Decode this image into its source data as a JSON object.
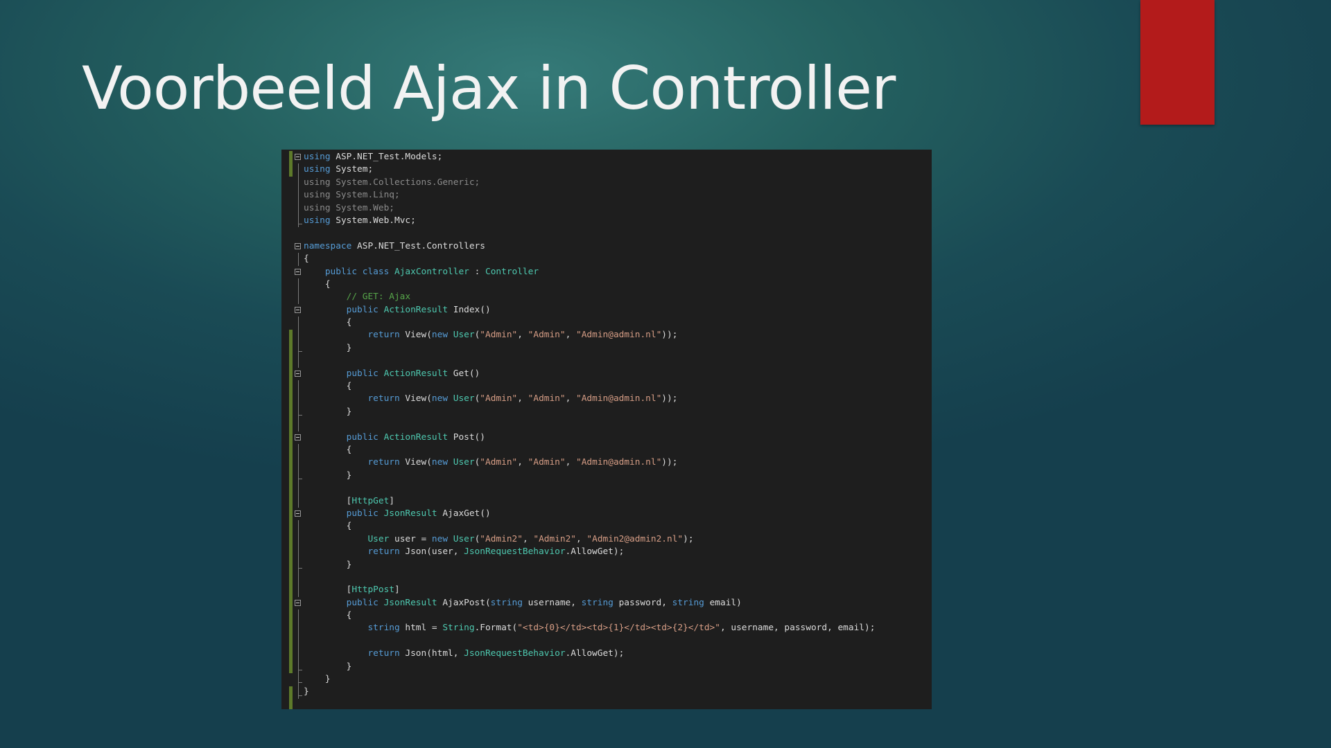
{
  "slide": {
    "title": "Voorbeeld Ajax in Controller",
    "accent_color": "#b31b1b"
  },
  "editor": {
    "colors": {
      "background": "#1e1e1e",
      "plain": "#dcdcdc",
      "keyword": "#569cd6",
      "type": "#4ec9b0",
      "string": "#d69d85",
      "comment": "#57a64a",
      "dimmed": "#8c8c8c",
      "change_marker": "#5d7a2a"
    },
    "change_markers": [
      {
        "from_line": 0,
        "to_line": 1
      },
      {
        "from_line": 14,
        "to_line": 40
      },
      {
        "from_line": 42,
        "to_line": 43
      }
    ],
    "lines": [
      {
        "fold": true,
        "guide": "",
        "indent": 0,
        "tokens": [
          {
            "t": "using",
            "c": "keyword"
          },
          {
            "t": " ASP.NET_Test.Models;",
            "c": "plain"
          }
        ]
      },
      {
        "fold": false,
        "guide": "line",
        "indent": 0,
        "tokens": [
          {
            "t": "using",
            "c": "keyword"
          },
          {
            "t": " System;",
            "c": "plain"
          }
        ]
      },
      {
        "fold": false,
        "guide": "line",
        "indent": 0,
        "tokens": [
          {
            "t": "using System.Collections.Generic;",
            "c": "dimmed"
          }
        ]
      },
      {
        "fold": false,
        "guide": "line",
        "indent": 0,
        "tokens": [
          {
            "t": "using System.Linq;",
            "c": "dimmed"
          }
        ]
      },
      {
        "fold": false,
        "guide": "line",
        "indent": 0,
        "tokens": [
          {
            "t": "using System.Web;",
            "c": "dimmed"
          }
        ]
      },
      {
        "fold": false,
        "guide": "end",
        "indent": 0,
        "tokens": [
          {
            "t": "using",
            "c": "keyword"
          },
          {
            "t": " System.Web.Mvc;",
            "c": "plain"
          }
        ]
      },
      {
        "fold": false,
        "guide": "",
        "indent": 0,
        "tokens": []
      },
      {
        "fold": true,
        "guide": "",
        "indent": 0,
        "tokens": [
          {
            "t": "namespace",
            "c": "keyword"
          },
          {
            "t": " ASP.NET_Test.Controllers",
            "c": "plain"
          }
        ]
      },
      {
        "fold": false,
        "guide": "line",
        "indent": 0,
        "tokens": [
          {
            "t": "{",
            "c": "plain"
          }
        ]
      },
      {
        "fold": true,
        "guide": "",
        "indent": 4,
        "tokens": [
          {
            "t": "public class ",
            "c": "keyword"
          },
          {
            "t": "AjaxController",
            "c": "type"
          },
          {
            "t": " : ",
            "c": "plain"
          },
          {
            "t": "Controller",
            "c": "type"
          }
        ]
      },
      {
        "fold": false,
        "guide": "line",
        "indent": 4,
        "tokens": [
          {
            "t": "{",
            "c": "plain"
          }
        ]
      },
      {
        "fold": false,
        "guide": "line",
        "indent": 8,
        "tokens": [
          {
            "t": "// GET: Ajax",
            "c": "comment"
          }
        ]
      },
      {
        "fold": true,
        "guide": "",
        "indent": 8,
        "tokens": [
          {
            "t": "public ",
            "c": "keyword"
          },
          {
            "t": "ActionResult",
            "c": "type"
          },
          {
            "t": " Index()",
            "c": "plain"
          }
        ]
      },
      {
        "fold": false,
        "guide": "line",
        "indent": 8,
        "tokens": [
          {
            "t": "{",
            "c": "plain"
          }
        ]
      },
      {
        "fold": false,
        "guide": "line",
        "indent": 12,
        "tokens": [
          {
            "t": "return",
            "c": "keyword"
          },
          {
            "t": " View(",
            "c": "plain"
          },
          {
            "t": "new ",
            "c": "keyword"
          },
          {
            "t": "User",
            "c": "type"
          },
          {
            "t": "(",
            "c": "plain"
          },
          {
            "t": "\"Admin\"",
            "c": "string"
          },
          {
            "t": ", ",
            "c": "plain"
          },
          {
            "t": "\"Admin\"",
            "c": "string"
          },
          {
            "t": ", ",
            "c": "plain"
          },
          {
            "t": "\"Admin@admin.nl\"",
            "c": "string"
          },
          {
            "t": "));",
            "c": "plain"
          }
        ]
      },
      {
        "fold": false,
        "guide": "end",
        "indent": 8,
        "tokens": [
          {
            "t": "}",
            "c": "plain"
          }
        ]
      },
      {
        "fold": false,
        "guide": "line",
        "indent": 0,
        "tokens": []
      },
      {
        "fold": true,
        "guide": "",
        "indent": 8,
        "tokens": [
          {
            "t": "public ",
            "c": "keyword"
          },
          {
            "t": "ActionResult",
            "c": "type"
          },
          {
            "t": " Get()",
            "c": "plain"
          }
        ]
      },
      {
        "fold": false,
        "guide": "line",
        "indent": 8,
        "tokens": [
          {
            "t": "{",
            "c": "plain"
          }
        ]
      },
      {
        "fold": false,
        "guide": "line",
        "indent": 12,
        "tokens": [
          {
            "t": "return",
            "c": "keyword"
          },
          {
            "t": " View(",
            "c": "plain"
          },
          {
            "t": "new ",
            "c": "keyword"
          },
          {
            "t": "User",
            "c": "type"
          },
          {
            "t": "(",
            "c": "plain"
          },
          {
            "t": "\"Admin\"",
            "c": "string"
          },
          {
            "t": ", ",
            "c": "plain"
          },
          {
            "t": "\"Admin\"",
            "c": "string"
          },
          {
            "t": ", ",
            "c": "plain"
          },
          {
            "t": "\"Admin@admin.nl\"",
            "c": "string"
          },
          {
            "t": "));",
            "c": "plain"
          }
        ]
      },
      {
        "fold": false,
        "guide": "end",
        "indent": 8,
        "tokens": [
          {
            "t": "}",
            "c": "plain"
          }
        ]
      },
      {
        "fold": false,
        "guide": "line",
        "indent": 0,
        "tokens": []
      },
      {
        "fold": true,
        "guide": "",
        "indent": 8,
        "tokens": [
          {
            "t": "public ",
            "c": "keyword"
          },
          {
            "t": "ActionResult",
            "c": "type"
          },
          {
            "t": " Post()",
            "c": "plain"
          }
        ]
      },
      {
        "fold": false,
        "guide": "line",
        "indent": 8,
        "tokens": [
          {
            "t": "{",
            "c": "plain"
          }
        ]
      },
      {
        "fold": false,
        "guide": "line",
        "indent": 12,
        "tokens": [
          {
            "t": "return",
            "c": "keyword"
          },
          {
            "t": " View(",
            "c": "plain"
          },
          {
            "t": "new ",
            "c": "keyword"
          },
          {
            "t": "User",
            "c": "type"
          },
          {
            "t": "(",
            "c": "plain"
          },
          {
            "t": "\"Admin\"",
            "c": "string"
          },
          {
            "t": ", ",
            "c": "plain"
          },
          {
            "t": "\"Admin\"",
            "c": "string"
          },
          {
            "t": ", ",
            "c": "plain"
          },
          {
            "t": "\"Admin@admin.nl\"",
            "c": "string"
          },
          {
            "t": "));",
            "c": "plain"
          }
        ]
      },
      {
        "fold": false,
        "guide": "end",
        "indent": 8,
        "tokens": [
          {
            "t": "}",
            "c": "plain"
          }
        ]
      },
      {
        "fold": false,
        "guide": "line",
        "indent": 0,
        "tokens": []
      },
      {
        "fold": false,
        "guide": "line",
        "indent": 8,
        "tokens": [
          {
            "t": "[",
            "c": "plain"
          },
          {
            "t": "HttpGet",
            "c": "type"
          },
          {
            "t": "]",
            "c": "plain"
          }
        ]
      },
      {
        "fold": true,
        "guide": "",
        "indent": 8,
        "tokens": [
          {
            "t": "public ",
            "c": "keyword"
          },
          {
            "t": "JsonResult",
            "c": "type"
          },
          {
            "t": " AjaxGet()",
            "c": "plain"
          }
        ]
      },
      {
        "fold": false,
        "guide": "line",
        "indent": 8,
        "tokens": [
          {
            "t": "{",
            "c": "plain"
          }
        ]
      },
      {
        "fold": false,
        "guide": "line",
        "indent": 12,
        "tokens": [
          {
            "t": "User",
            "c": "type"
          },
          {
            "t": " user = ",
            "c": "plain"
          },
          {
            "t": "new ",
            "c": "keyword"
          },
          {
            "t": "User",
            "c": "type"
          },
          {
            "t": "(",
            "c": "plain"
          },
          {
            "t": "\"Admin2\"",
            "c": "string"
          },
          {
            "t": ", ",
            "c": "plain"
          },
          {
            "t": "\"Admin2\"",
            "c": "string"
          },
          {
            "t": ", ",
            "c": "plain"
          },
          {
            "t": "\"Admin2@admin2.nl\"",
            "c": "string"
          },
          {
            "t": ");",
            "c": "plain"
          }
        ]
      },
      {
        "fold": false,
        "guide": "line",
        "indent": 12,
        "tokens": [
          {
            "t": "return",
            "c": "keyword"
          },
          {
            "t": " Json(user, ",
            "c": "plain"
          },
          {
            "t": "JsonRequestBehavior",
            "c": "type"
          },
          {
            "t": ".AllowGet);",
            "c": "plain"
          }
        ]
      },
      {
        "fold": false,
        "guide": "end",
        "indent": 8,
        "tokens": [
          {
            "t": "}",
            "c": "plain"
          }
        ]
      },
      {
        "fold": false,
        "guide": "line",
        "indent": 0,
        "tokens": []
      },
      {
        "fold": false,
        "guide": "line",
        "indent": 8,
        "tokens": [
          {
            "t": "[",
            "c": "plain"
          },
          {
            "t": "HttpPost",
            "c": "type"
          },
          {
            "t": "]",
            "c": "plain"
          }
        ]
      },
      {
        "fold": true,
        "guide": "",
        "indent": 8,
        "tokens": [
          {
            "t": "public ",
            "c": "keyword"
          },
          {
            "t": "JsonResult",
            "c": "type"
          },
          {
            "t": " AjaxPost(",
            "c": "plain"
          },
          {
            "t": "string",
            "c": "keyword"
          },
          {
            "t": " username, ",
            "c": "plain"
          },
          {
            "t": "string",
            "c": "keyword"
          },
          {
            "t": " password, ",
            "c": "plain"
          },
          {
            "t": "string",
            "c": "keyword"
          },
          {
            "t": " email)",
            "c": "plain"
          }
        ]
      },
      {
        "fold": false,
        "guide": "line",
        "indent": 8,
        "tokens": [
          {
            "t": "{",
            "c": "plain"
          }
        ]
      },
      {
        "fold": false,
        "guide": "line",
        "indent": 12,
        "tokens": [
          {
            "t": "string",
            "c": "keyword"
          },
          {
            "t": " html = ",
            "c": "plain"
          },
          {
            "t": "String",
            "c": "type"
          },
          {
            "t": ".Format(",
            "c": "plain"
          },
          {
            "t": "\"<td>{0}</td><td>{1}</td><td>{2}</td>\"",
            "c": "string"
          },
          {
            "t": ", username, password, email);",
            "c": "plain"
          }
        ]
      },
      {
        "fold": false,
        "guide": "line",
        "indent": 0,
        "tokens": []
      },
      {
        "fold": false,
        "guide": "line",
        "indent": 12,
        "tokens": [
          {
            "t": "return",
            "c": "keyword"
          },
          {
            "t": " Json(html, ",
            "c": "plain"
          },
          {
            "t": "JsonRequestBehavior",
            "c": "type"
          },
          {
            "t": ".AllowGet);",
            "c": "plain"
          }
        ]
      },
      {
        "fold": false,
        "guide": "end",
        "indent": 8,
        "tokens": [
          {
            "t": "}",
            "c": "plain"
          }
        ]
      },
      {
        "fold": false,
        "guide": "end",
        "indent": 4,
        "tokens": [
          {
            "t": "}",
            "c": "plain"
          }
        ]
      },
      {
        "fold": false,
        "guide": "end",
        "indent": 0,
        "tokens": [
          {
            "t": "}",
            "c": "plain"
          }
        ]
      }
    ]
  }
}
